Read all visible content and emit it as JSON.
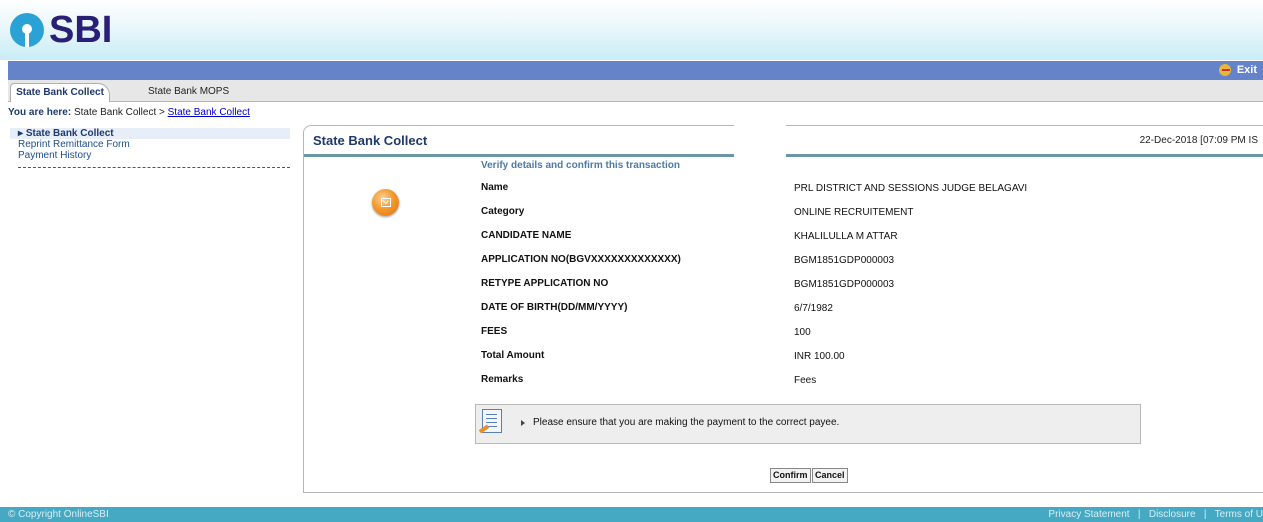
{
  "brand": {
    "logo_text": "SBI"
  },
  "topbar": {
    "exit_label": "Exit"
  },
  "tabs": [
    {
      "label": "State Bank Collect",
      "active": true
    },
    {
      "label": "State Bank MOPS",
      "active": false
    }
  ],
  "breadcrumb": {
    "prefix": "You are here:",
    "path": "State Bank Collect >",
    "link": "State Bank Collect"
  },
  "leftnav": {
    "items": [
      {
        "label": "State Bank Collect",
        "active": true
      },
      {
        "label": "Reprint Remittance Form",
        "active": false
      },
      {
        "label": "Payment History",
        "active": false
      }
    ]
  },
  "panel": {
    "title": "State Bank Collect",
    "datetime": "22-Dec-2018 [07:09 PM IS",
    "heading": "Verify details and confirm this transaction",
    "fields": [
      {
        "label": "Name",
        "value": "PRL DISTRICT AND SESSIONS JUDGE BELAGAVI"
      },
      {
        "label": "Category",
        "value": "ONLINE RECRUITEMENT"
      },
      {
        "label": "CANDIDATE NAME",
        "value": "KHALILULLA M ATTAR"
      },
      {
        "label": "APPLICATION NO(BGVXXXXXXXXXXXXX)",
        "value": "BGM1851GDP000003"
      },
      {
        "label": "RETYPE APPLICATION NO",
        "value": "BGM1851GDP000003"
      },
      {
        "label": "DATE OF BIRTH(DD/MM/YYYY)",
        "value": "6/7/1982"
      },
      {
        "label": "FEES",
        "value": "100"
      },
      {
        "label": "Total Amount",
        "value": "INR 100.00"
      },
      {
        "label": "Remarks",
        "value": "Fees"
      }
    ],
    "notice": "Please ensure that you are making the payment to the correct payee.",
    "confirm_label": "Confirm",
    "cancel_label": "Cancel"
  },
  "footer": {
    "copyright": "© Copyright OnlineSBI",
    "links": [
      "Privacy Statement",
      "Disclosure",
      "Terms of U"
    ]
  },
  "colors": {
    "brand_blue": "#2aa2d6",
    "brand_navy": "#292075",
    "bar": "#6583c9",
    "footer": "#46a9c3"
  }
}
